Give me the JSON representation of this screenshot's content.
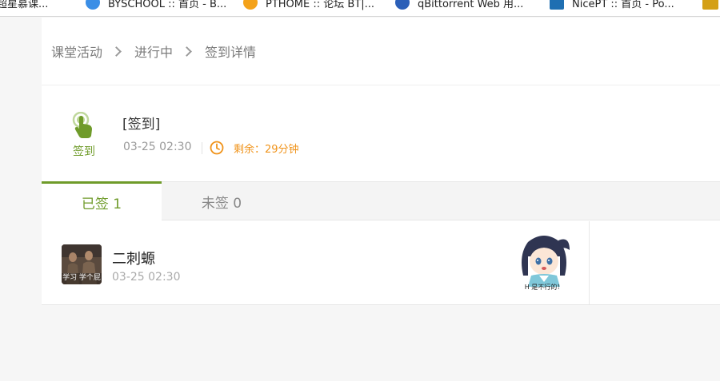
{
  "bookmarks": [
    {
      "label": "超星慕课...",
      "icon": "bookmark-icon",
      "color": "#c0392b"
    },
    {
      "label": "BYSCHOOL :: 首页 - B...",
      "icon": "globe-icon",
      "color": "#3a8ee6"
    },
    {
      "label": "PTHOME :: 论坛 BT|...",
      "icon": "pt-icon",
      "color": "#f4a21a"
    },
    {
      "label": "qBittorrent Web 用...",
      "icon": "qbittorrent-icon",
      "color": "#2b5fb8"
    },
    {
      "label": "NicePT :: 首页 - Po...",
      "icon": "nicept-icon",
      "color": "#1f6fb2"
    },
    {
      "label": "",
      "icon": "folder-icon",
      "color": "#d4a017"
    }
  ],
  "breadcrumb": {
    "items": [
      "课堂活动",
      "进行中",
      "签到详情"
    ]
  },
  "activity": {
    "type_label": "签到",
    "title": "[签到]",
    "start_time": "03-25 02:30",
    "remaining": "剩余：29分钟",
    "accent_color": "#6f9b2a",
    "remaining_color": "#f0931a"
  },
  "tabs": [
    {
      "label": "已签 1",
      "active": true
    },
    {
      "label": "未签 0",
      "active": false
    }
  ],
  "signed_list": [
    {
      "name": "二刺螈",
      "time": "03-25 02:30",
      "avatar_caption": "学习 学个屁",
      "sticker_caption": "H 是不行的！"
    }
  ]
}
